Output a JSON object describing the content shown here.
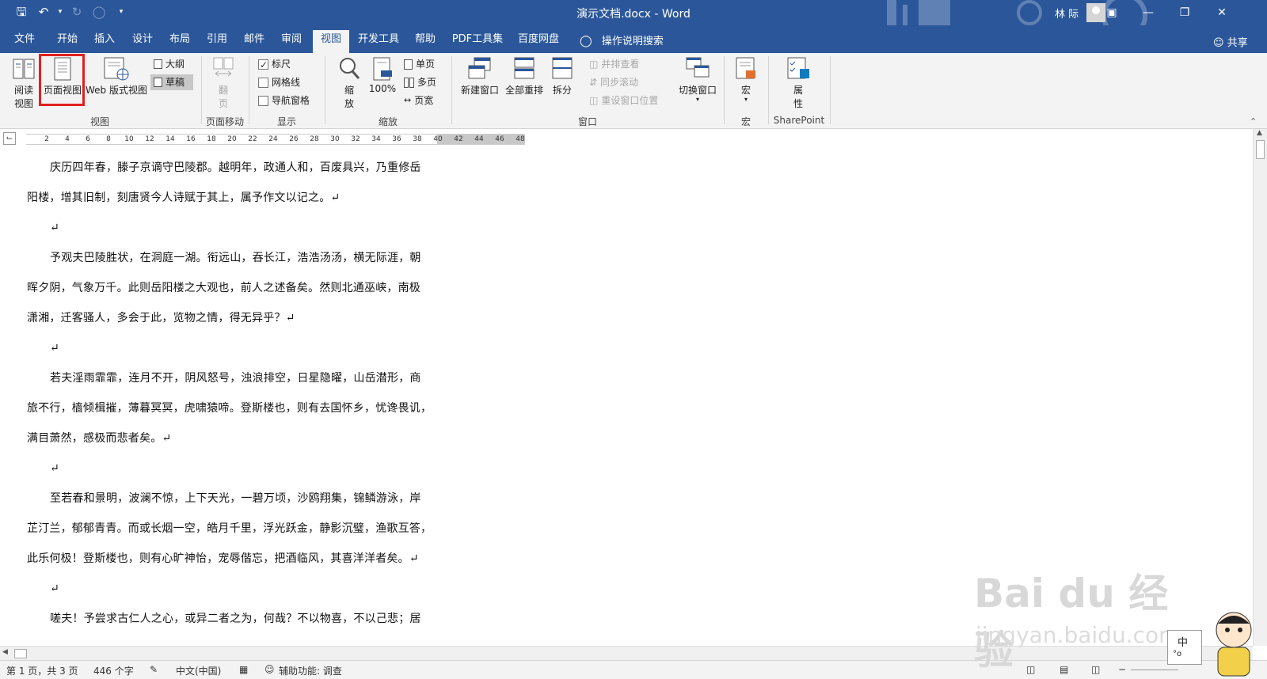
{
  "titlebar": {
    "title": "演示文档.docx  -  Word",
    "user": "林 际",
    "colors": {
      "accent": "#2b579a",
      "highlight": "#e02020"
    }
  },
  "tabs": [
    {
      "label": "文件"
    },
    {
      "label": "开始"
    },
    {
      "label": "插入"
    },
    {
      "label": "设计"
    },
    {
      "label": "布局"
    },
    {
      "label": "引用"
    },
    {
      "label": "邮件"
    },
    {
      "label": "审阅"
    },
    {
      "label": "视图",
      "active": true
    },
    {
      "label": "开发工具"
    },
    {
      "label": "帮助"
    },
    {
      "label": "PDF工具集"
    },
    {
      "label": "百度网盘"
    }
  ],
  "help_search": "操作说明搜索",
  "share": "共享",
  "ribbon": {
    "views": {
      "read": "阅读\n视图",
      "read_l1": "阅读",
      "read_l2": "视图",
      "page": "页面视图",
      "web": "Web 版式视图",
      "outline": "大纲",
      "draft": "草稿",
      "label": "视图"
    },
    "page_move": {
      "flip_l1": "翻",
      "flip_l2": "页",
      "label": "页面移动"
    },
    "show": {
      "ruler": "标尺",
      "gridlines": "网格线",
      "nav": "导航窗格",
      "label": "显示"
    },
    "zoom": {
      "zoom_l1": "缩",
      "zoom_l2": "放",
      "hundred": "100%",
      "one_page": "单页",
      "multi_page": "多页",
      "page_width": "页宽",
      "label": "缩放"
    },
    "window": {
      "new_window": "新建窗口",
      "arrange_all": "全部重排",
      "split": "拆分",
      "side_by_side": "并排查看",
      "sync_scroll": "同步滚动",
      "reset_pos": "重设窗口位置",
      "switch": "切换窗口",
      "label": "窗口"
    },
    "macros": {
      "macro": "宏",
      "label": "宏"
    },
    "sharepoint": {
      "props_l1": "属",
      "props_l2": "性",
      "label": "SharePoint"
    }
  },
  "ruler_ticks": [
    "2",
    "4",
    "6",
    "8",
    "10",
    "12",
    "14",
    "16",
    "18",
    "20",
    "22",
    "24",
    "26",
    "28",
    "30",
    "32",
    "34",
    "36",
    "38",
    "40",
    "42",
    "44",
    "46",
    "48"
  ],
  "document": {
    "paragraphs": [
      [
        "庆历四年春，滕子京谪守巴陵郡。越明年，政通人和，百废具兴，乃重修岳",
        "阳楼，增其旧制，刻唐贤今人诗赋于其上，属予作文以记之。↵"
      ],
      [
        "↵"
      ],
      [
        "予观夫巴陵胜状，在洞庭一湖。衔远山，吞长江，浩浩汤汤，横无际涯，朝",
        "晖夕阴，气象万千。此则岳阳楼之大观也，前人之述备矣。然则北通巫峡，南极",
        "潇湘，迁客骚人，多会于此，览物之情，得无异乎？↵"
      ],
      [
        "↵"
      ],
      [
        "若夫淫雨霏霏，连月不开，阴风怒号，浊浪排空，日星隐曜，山岳潜形，商",
        "旅不行，樯倾楫摧，薄暮冥冥，虎啸猿啼。登斯楼也，则有去国怀乡，忧谗畏讥，",
        "满目萧然，感极而悲者矣。↵"
      ],
      [
        "↵"
      ],
      [
        "至若春和景明，波澜不惊，上下天光，一碧万顷，沙鸥翔集，锦鳞游泳，岸",
        "芷汀兰，郁郁青青。而或长烟一空，皓月千里，浮光跃金，静影沉璧，渔歌互答，",
        "此乐何极！登斯楼也，则有心旷神怡，宠辱偕忘，把酒临风，其喜洋洋者矣。↵"
      ],
      [
        "↵"
      ],
      [
        "嗟夫！予尝求古仁人之心，或异二者之为，何哉？不以物喜，不以己悲；居"
      ]
    ]
  },
  "statusbar": {
    "page": "第 1 页，共 3 页",
    "words": "446 个字",
    "language": "中文(中国)",
    "accessibility": "辅助功能: 调查"
  },
  "watermark": {
    "brand": "Bai du 经验",
    "url": "jingyan.baidu.com"
  },
  "ime": {
    "mode": "中"
  }
}
